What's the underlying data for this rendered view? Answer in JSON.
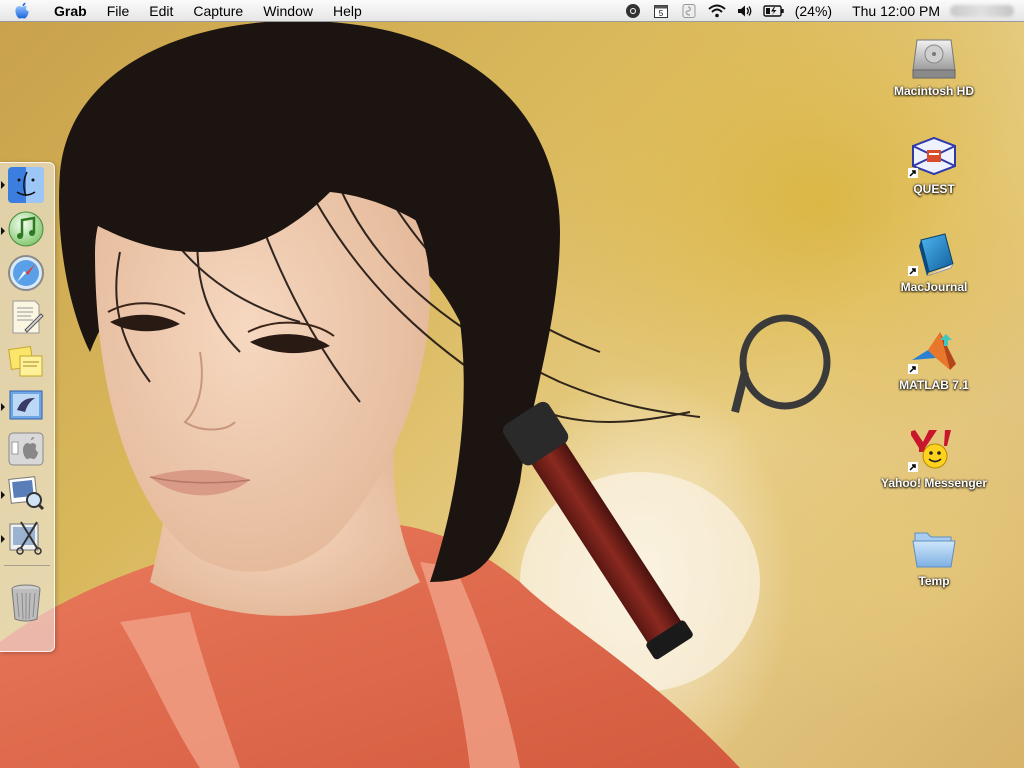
{
  "menubar": {
    "app_name": "Grab",
    "menus": [
      "File",
      "Edit",
      "Capture",
      "Window",
      "Help"
    ],
    "battery_text": "(24%)",
    "clock": "Thu 12:00 PM",
    "status_icons": [
      "chrome-icon",
      "calendar-icon",
      "script-icon",
      "wifi-icon",
      "volume-icon",
      "battery-icon"
    ],
    "calendar_day": "5"
  },
  "dock": {
    "items": [
      {
        "name": "finder-icon",
        "running": true
      },
      {
        "name": "itunes-icon",
        "running": true
      },
      {
        "name": "safari-icon",
        "running": false
      },
      {
        "name": "textedit-icon",
        "running": false
      },
      {
        "name": "stickies-icon",
        "running": false
      },
      {
        "name": "mail-icon",
        "running": true
      },
      {
        "name": "system-preferences-icon",
        "running": false
      },
      {
        "name": "preview-icon",
        "running": true
      },
      {
        "name": "grab-icon",
        "running": true
      },
      {
        "name": "trash-icon",
        "running": false
      }
    ]
  },
  "desktop_icons": [
    {
      "name": "macintosh-hd",
      "label": "Macintosh HD",
      "icon": "hard-drive-icon",
      "alias": false
    },
    {
      "name": "quest",
      "label": "QUEST",
      "icon": "quest-icon",
      "alias": true
    },
    {
      "name": "macjournal",
      "label": "MacJournal",
      "icon": "book-icon",
      "alias": true
    },
    {
      "name": "matlab",
      "label": "MATLAB 7.1",
      "icon": "matlab-icon",
      "alias": true
    },
    {
      "name": "yahoo-messenger",
      "label": "Yahoo! Messenger",
      "icon": "yahoo-icon",
      "alias": true
    },
    {
      "name": "temp",
      "label": "Temp",
      "icon": "folder-icon",
      "alias": false
    }
  ],
  "colors": {
    "wallpaper": "#d9b85c",
    "robe": "#e0664a",
    "hair": "#1c1410",
    "skin": "#f2cdb0"
  }
}
